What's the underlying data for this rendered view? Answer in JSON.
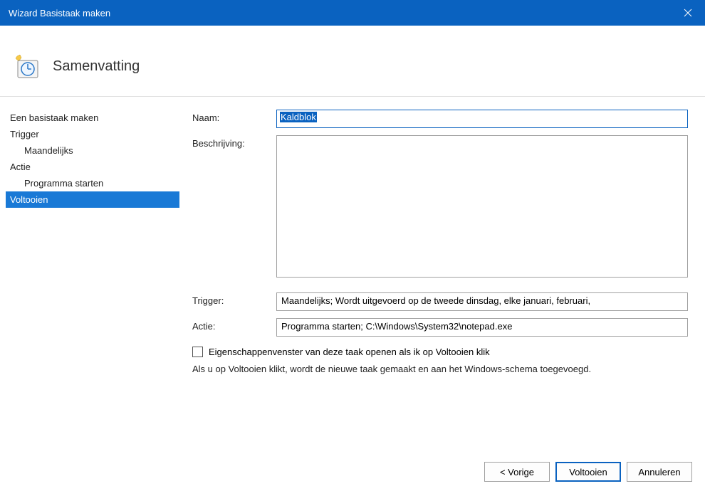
{
  "titlebar": {
    "title": "Wizard Basistaak maken"
  },
  "header": {
    "title": "Samenvatting"
  },
  "sidebar": {
    "items": [
      {
        "label": "Een basistaak maken",
        "sub": false,
        "selected": false
      },
      {
        "label": "Trigger",
        "sub": false,
        "selected": false
      },
      {
        "label": "Maandelijks",
        "sub": true,
        "selected": false
      },
      {
        "label": "Actie",
        "sub": false,
        "selected": false
      },
      {
        "label": "Programma starten",
        "sub": true,
        "selected": false
      },
      {
        "label": "Voltooien",
        "sub": false,
        "selected": true
      }
    ]
  },
  "main": {
    "labels": {
      "name": "Naam:",
      "description": "Beschrijving:",
      "trigger": "Trigger:",
      "action": "Actie:"
    },
    "values": {
      "name": "Kaldblok",
      "description": "",
      "trigger": "Maandelijks; Wordt uitgevoerd op de tweede dinsdag, elke januari, februari,",
      "action": "Programma starten; C:\\Windows\\System32\\notepad.exe"
    },
    "checkbox_label": "Eigenschappenvenster van deze taak openen als ik op Voltooien klik",
    "checkbox_checked": false,
    "hint": "Als u op Voltooien klikt, wordt de nieuwe taak gemaakt en aan het Windows-schema toegevoegd."
  },
  "footer": {
    "back": "< Vorige",
    "finish": "Voltooien",
    "cancel": "Annuleren"
  }
}
